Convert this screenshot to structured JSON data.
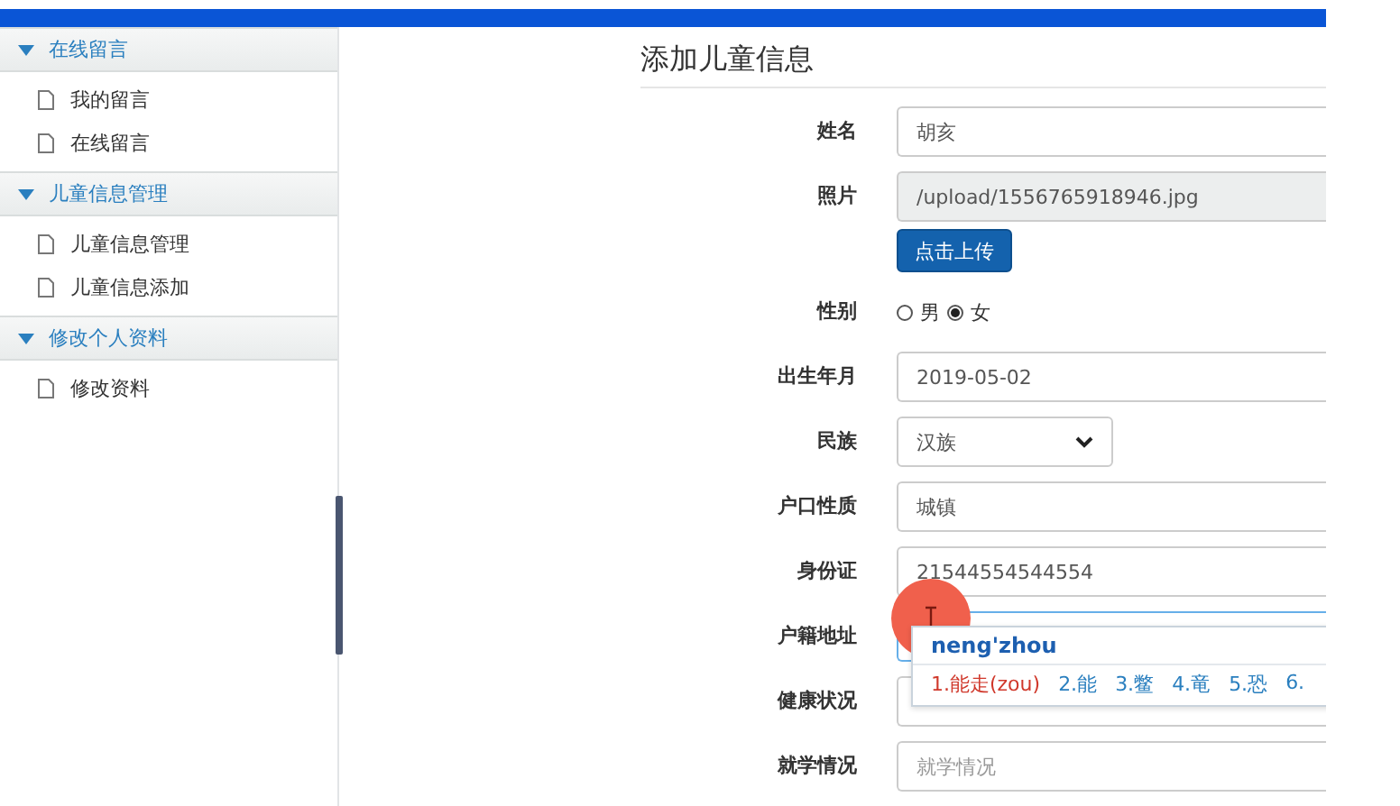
{
  "sidebar": {
    "sections": [
      {
        "title": "在线留言",
        "expanded": true,
        "items": [
          "我的留言",
          "在线留言"
        ]
      },
      {
        "title": "儿童信息管理",
        "expanded": true,
        "items": [
          "儿童信息管理",
          "儿童信息添加"
        ]
      },
      {
        "title": "修改个人资料",
        "expanded": true,
        "items": [
          "修改资料"
        ]
      }
    ]
  },
  "form": {
    "title": "添加儿童信息",
    "fields": [
      {
        "label": "姓名",
        "kind": "text",
        "value": "胡亥"
      },
      {
        "label": "照片",
        "kind": "file",
        "value": "/upload/1556765918946.jpg",
        "button": "点击上传"
      },
      {
        "label": "性别",
        "kind": "radio",
        "options": [
          {
            "label": "男",
            "selected": false
          },
          {
            "label": "女",
            "selected": true
          }
        ]
      },
      {
        "label": "出生年月",
        "kind": "text",
        "value": "2019-05-02"
      },
      {
        "label": "民族",
        "kind": "select",
        "value": "汉族"
      },
      {
        "label": "户口性质",
        "kind": "text",
        "value": "城镇"
      },
      {
        "label": "身份证",
        "kind": "text",
        "value": "21544554544554"
      },
      {
        "label": "户籍地址",
        "kind": "text",
        "focused": true
      },
      {
        "label": "健康状况",
        "kind": "text"
      },
      {
        "label": "就学情况",
        "kind": "text",
        "placeholder": "就学情况"
      }
    ]
  },
  "ime": {
    "composition": "neng'zhou",
    "candidates": [
      {
        "text": "1.能走(zou)",
        "selected": true
      },
      {
        "text": "2.能",
        "selected": false
      },
      {
        "text": "3.鳖",
        "selected": false
      },
      {
        "text": "4.竜",
        "selected": false
      },
      {
        "text": "5.恐",
        "selected": false
      },
      {
        "text": "6.",
        "selected": false
      }
    ]
  }
}
